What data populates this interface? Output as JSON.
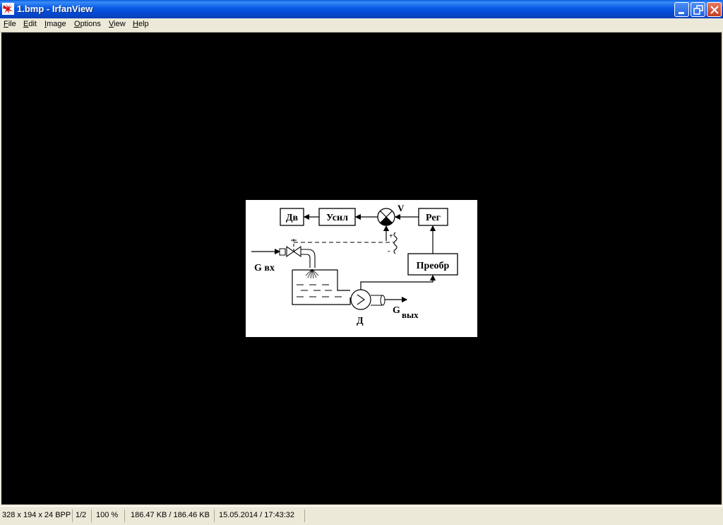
{
  "window": {
    "title": "1.bmp - IrfanView",
    "icon": "irfanview-red-cat-icon"
  },
  "menu": {
    "items": [
      {
        "label": "File"
      },
      {
        "label": "Edit"
      },
      {
        "label": "Image"
      },
      {
        "label": "Options"
      },
      {
        "label": "View"
      },
      {
        "label": "Help"
      }
    ]
  },
  "diagram": {
    "blocks": {
      "dv": "Дв",
      "usil": "Усил",
      "reg": "Рег",
      "preobr": "Преобр"
    },
    "labels": {
      "v": "V",
      "g_in": "G вх",
      "g_out_main": "G",
      "g_out_sub": "вых",
      "d": "Д",
      "plus": "+",
      "minus": "-"
    }
  },
  "status": {
    "dimensions": "328 x 194 x 24 BPP",
    "page": "1/2",
    "zoom": "100 %",
    "size": "186.47 KB / 186.46 KB",
    "datetime": "15.05.2014 / 17:43:32"
  },
  "colors": {
    "titlebar": "#0b5ee6",
    "viewer_bg": "#000000",
    "image_bg": "#ffffff"
  }
}
